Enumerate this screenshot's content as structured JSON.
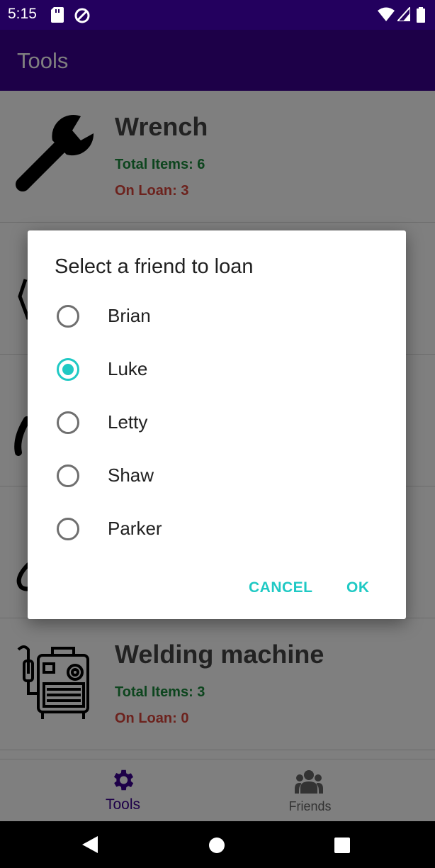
{
  "status_bar": {
    "time": "5:15",
    "icons": [
      "sd-card-icon",
      "data-saver-icon",
      "wifi-icon",
      "signal-icon",
      "battery-icon"
    ]
  },
  "app_bar": {
    "title": "Tools"
  },
  "tools": [
    {
      "name": "Wrench",
      "total": "Total Items: 6",
      "on_loan": "On Loan: 3",
      "icon": "wrench-icon"
    },
    {
      "name": "",
      "total": "",
      "on_loan": "",
      "icon": "tool-icon"
    },
    {
      "name": "",
      "total": "",
      "on_loan": "",
      "icon": "tool-icon"
    },
    {
      "name": "",
      "total": "",
      "on_loan": "",
      "icon": "tool-icon"
    },
    {
      "name": "Welding machine",
      "total": "Total Items: 3",
      "on_loan": "On Loan: 0",
      "icon": "welding-machine-icon"
    }
  ],
  "dialog": {
    "title": "Select a friend to loan",
    "options": [
      {
        "label": "Brian",
        "selected": false
      },
      {
        "label": "Luke",
        "selected": true
      },
      {
        "label": "Letty",
        "selected": false
      },
      {
        "label": "Shaw",
        "selected": false
      },
      {
        "label": "Parker",
        "selected": false
      }
    ],
    "cancel_label": "CANCEL",
    "ok_label": "OK"
  },
  "bottom_nav": {
    "tools_label": "Tools",
    "friends_label": "Friends",
    "active": "Tools"
  },
  "colors": {
    "primary": "#3b0091",
    "primary_dark": "#23005e",
    "accent": "#1fc9c4",
    "total_green": "#1a8a3c",
    "loan_red": "#d9443a"
  }
}
